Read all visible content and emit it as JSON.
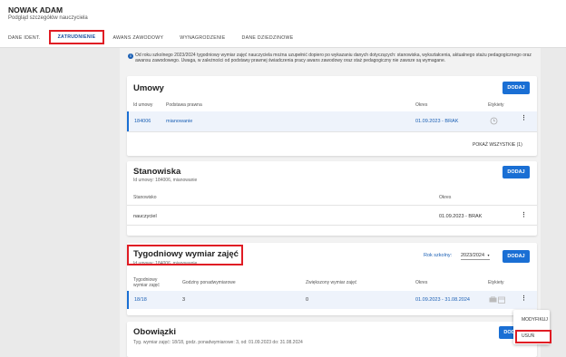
{
  "header": {
    "title": "NOWAK ADAM",
    "subtitle": "Podgląd szczegółów nauczyciela"
  },
  "tabs": [
    {
      "label": "DANE IDENT."
    },
    {
      "label": "ZATRUDNIENIE"
    },
    {
      "label": "AWANS ZAWODOWY"
    },
    {
      "label": "WYNAGRODZENIE"
    },
    {
      "label": "DANE DZIEDZINOWE"
    }
  ],
  "info": {
    "text": "Od roku szkolnego 2023/2024 tygodniowy wymiar zajęć nauczyciela można uzupełnić dopiero po wykazaniu danych dotyczących: stanowiska, wykształcenia, aktualnego stażu pedagogicznego oraz awansu zawodowego. Uwaga, w zależności od podstawy prawnej świadczenia pracy awans zawodowy oraz staż pedagogiczny nie zawsze są wymagane."
  },
  "umowy": {
    "title": "Umowy",
    "add_label": "DODAJ",
    "columns": [
      "Id umowy",
      "Podstawa prawna",
      "Okres",
      "Etykiety"
    ],
    "row": {
      "id": "184006",
      "basis": "mianowanie",
      "period": "01.09.2023 - BRAK"
    },
    "show_all": "POKAŻ WSZYSTKIE (1)"
  },
  "stanowiska": {
    "title": "Stanowiska",
    "subtitle": "Id umowy: 184006, mianowanie",
    "add_label": "DODAJ",
    "columns": [
      "Stanowisko",
      "Okres"
    ],
    "row": {
      "position": "nauczyciel",
      "period": "01.09.2023 - BRAK"
    }
  },
  "wymiar": {
    "title": "Tygodniowy wymiar zajęć",
    "subtitle": "Id umowy: 184006, mianowanie",
    "school_year_label": "Rok szkolny:",
    "school_year_value": "2023/2024",
    "add_label": "DODAJ",
    "columns": [
      "Tygodniowy wymiar zajęć",
      "Godziny ponadwymiarowe",
      "Zwiększony wymiar zajęć",
      "Okres",
      "Etykiety"
    ],
    "row": {
      "wymiar": "18/18",
      "godziny": "3",
      "zwiekszony": "0",
      "period": "01.09.2023 - 31.08.2024"
    }
  },
  "obowiazki": {
    "title": "Obowiązki",
    "subtitle": "Tyg. wymiar zajęć: 18/18, godz. ponadwymiarowe: 3, od: 01.09.2023 do: 31.08.2024",
    "add_label": "DODAJ"
  },
  "context_menu": {
    "items": [
      {
        "label": "MODYFIKUJ"
      },
      {
        "label": "USUŃ"
      }
    ]
  },
  "colors": {
    "accent": "#1a6fd4",
    "highlight": "#e01c24"
  }
}
